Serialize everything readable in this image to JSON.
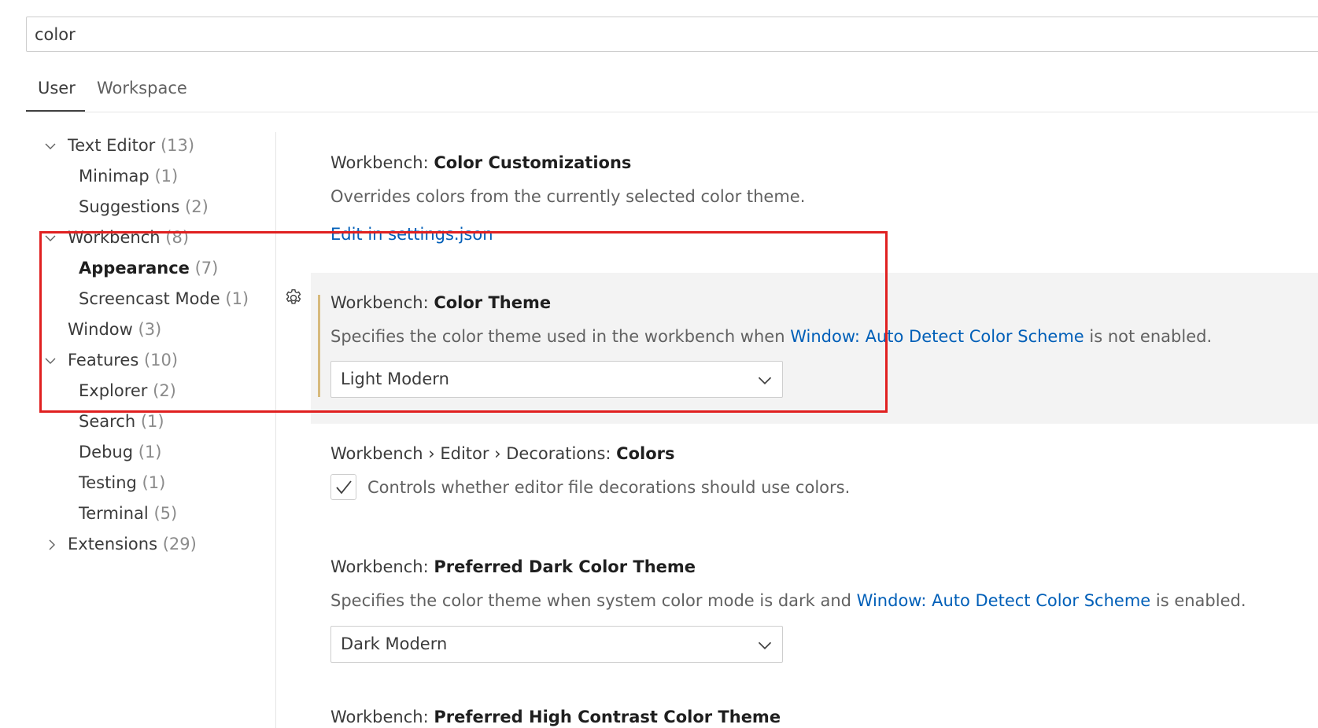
{
  "search": {
    "value": "color"
  },
  "tabs": [
    {
      "label": "User"
    },
    {
      "label": "Workspace"
    }
  ],
  "toc": {
    "text_editor": {
      "name": "Text Editor",
      "count": "(13)"
    },
    "minimap": {
      "name": "Minimap",
      "count": "(1)"
    },
    "suggestions": {
      "name": "Suggestions",
      "count": "(2)"
    },
    "workbench": {
      "name": "Workbench",
      "count": "(8)"
    },
    "appearance": {
      "name": "Appearance",
      "count": "(7)"
    },
    "screencast": {
      "name": "Screencast Mode",
      "count": "(1)"
    },
    "window": {
      "name": "Window",
      "count": "(3)"
    },
    "features": {
      "name": "Features",
      "count": "(10)"
    },
    "explorer": {
      "name": "Explorer",
      "count": "(2)"
    },
    "search": {
      "name": "Search",
      "count": "(1)"
    },
    "debug": {
      "name": "Debug",
      "count": "(1)"
    },
    "testing": {
      "name": "Testing",
      "count": "(1)"
    },
    "terminal": {
      "name": "Terminal",
      "count": "(5)"
    },
    "extensions": {
      "name": "Extensions",
      "count": "(29)"
    }
  },
  "settings": {
    "color_customizations": {
      "prefix": "Workbench: ",
      "key": "Color Customizations",
      "description": "Overrides colors from the currently selected color theme.",
      "link": "Edit in settings.json"
    },
    "color_theme": {
      "prefix": "Workbench: ",
      "key": "Color Theme",
      "desc_before": "Specifies the color theme used in the workbench when ",
      "desc_link": "Window: Auto Detect Color Scheme",
      "desc_after": " is not enabled.",
      "value": "Light Modern"
    },
    "decorations_colors": {
      "prefix": "Workbench › Editor › Decorations: ",
      "key": "Colors",
      "description": "Controls whether editor file decorations should use colors.",
      "checked": true
    },
    "preferred_dark": {
      "prefix": "Workbench: ",
      "key": "Preferred Dark Color Theme",
      "desc_before": "Specifies the color theme when system color mode is dark and ",
      "desc_link": "Window: Auto Detect Color Scheme",
      "desc_after": " is enabled.",
      "value": "Dark Modern"
    },
    "preferred_hc": {
      "prefix": "Workbench: ",
      "key": "Preferred High Contrast Color Theme"
    }
  },
  "colors": {
    "link": "#005fb8",
    "highlight_box": "#e02020",
    "focus_bar": "#d7ba7d",
    "focused_bg": "#f3f3f3"
  },
  "icons": [
    "chevron-down-icon",
    "chevron-right-icon",
    "gear-icon",
    "check-icon"
  ]
}
